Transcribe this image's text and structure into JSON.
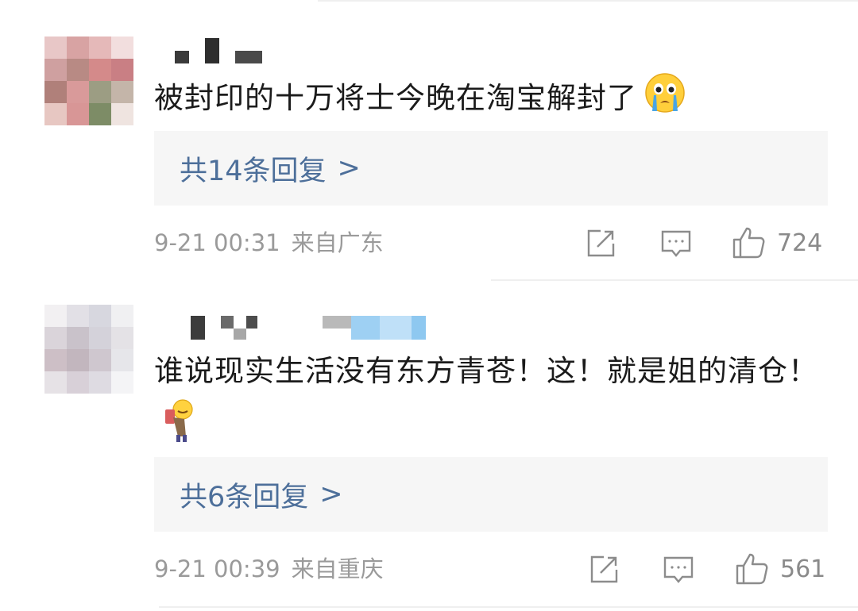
{
  "comments": [
    {
      "text": "被封印的十万将士今晚在淘宝解封了",
      "emoji": "crying-face-icon",
      "reply_label": "共14条回复",
      "reply_arrow": ">",
      "date": "9-21 00:31",
      "location": "来自广东",
      "likes": "724"
    },
    {
      "text": "谁说现实生活没有东方青苍！这！就是姐的清仓！",
      "emoji": "bowing-person-icon",
      "reply_label": "共6条回复",
      "reply_arrow": ">",
      "date": "9-21 00:39",
      "location": "来自重庆",
      "likes": "561"
    }
  ],
  "icons": {
    "share": "share-icon",
    "comment": "comment-icon",
    "like": "thumbs-up-icon"
  },
  "colors": {
    "link": "#4d6f9a",
    "meta": "#9a9a9a",
    "reply_bg": "#f6f6f6"
  }
}
